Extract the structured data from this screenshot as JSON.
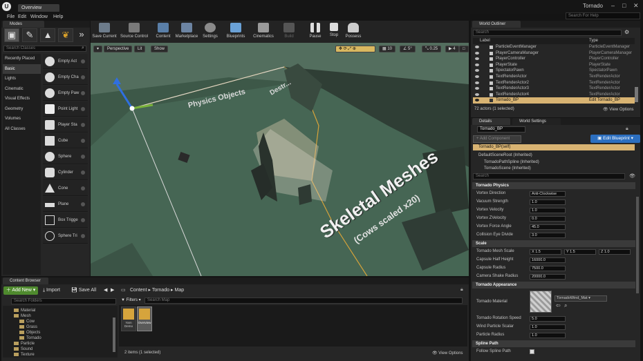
{
  "window": {
    "map_tab": "Overview",
    "project": "Tornado",
    "help_search_placeholder": "Search For Help"
  },
  "menu": [
    "File",
    "Edit",
    "Window",
    "Help"
  ],
  "modes": {
    "tab": "Modes",
    "search_placeholder": "Search Classes",
    "categories": [
      "Recently Placed",
      "Basic",
      "Lights",
      "Cinematic",
      "Visual Effects",
      "Geometry",
      "Volumes",
      "All Classes"
    ],
    "selected_category": "Basic",
    "actors": [
      "Empty Act",
      "Empty Cha",
      "Empty Paw",
      "Point Light",
      "Player Sta",
      "Cube",
      "Sphere",
      "Cylinder",
      "Cone",
      "Plane",
      "Box Trigge",
      "Sphere Tri"
    ]
  },
  "toolbar": [
    "Save Current",
    "Source Control",
    "Content",
    "Marketplace",
    "Settings",
    "Blueprints",
    "Cinematics",
    "Build",
    "Pause",
    "Stop",
    "Possess"
  ],
  "viewport": {
    "buttons": [
      "Perspective",
      "Lit",
      "Show"
    ],
    "snap_grid": "10",
    "snap_rot": "5°",
    "snap_scale": "0.25",
    "camera_speed": "4",
    "labels": {
      "physics": "Physics Objects",
      "destructible": "Destr...",
      "skeletal": "Skeletal Meshes",
      "cows": "(Cows scaled x20)"
    }
  },
  "world_outliner": {
    "tab": "World Outliner",
    "search_placeholder": "Search",
    "col_label": "Label",
    "col_type": "Type",
    "rows": [
      [
        "ParticleEventManager",
        "ParticleEventManager"
      ],
      [
        "PlayerCameraManager",
        "PlayerCameraManager"
      ],
      [
        "PlayerController",
        "PlayerController"
      ],
      [
        "PlayerState",
        "PlayerState"
      ],
      [
        "SpectatorPawn",
        "SpectatorPawn"
      ],
      [
        "TextRenderActor",
        "TextRenderActor"
      ],
      [
        "TextRenderActor2",
        "TextRenderActor"
      ],
      [
        "TextRenderActor3",
        "TextRenderActor"
      ],
      [
        "TextRenderActor4",
        "TextRenderActor"
      ],
      [
        "Tornado_BP",
        "Edit Tornado_BP"
      ]
    ],
    "selected": "Tornado_BP",
    "count": "72 actors (1 selected)",
    "view_options": "View Options"
  },
  "details": {
    "tab": "Details",
    "tab2": "World Settings",
    "name": "Tornado_BP",
    "add_component": "+ Add Component",
    "edit_blueprint": "Edit Blueprint",
    "components": [
      "Tornado_BP(self)",
      "DefaultSceneRoot (Inherited)",
      "TornadoPathSpline (Inherited)",
      "TornadoScene (Inherited)"
    ],
    "search_placeholder": "Search",
    "physics_title": "Tornado Physics",
    "physics": [
      [
        "Vortex Direction",
        "Anti-Clockwise"
      ],
      [
        "Vacuum Strength",
        "1.0"
      ],
      [
        "Vortex Velocity",
        "1.0"
      ],
      [
        "Vortex ZVelocity",
        "0.0"
      ],
      [
        "Vortex Force Angle",
        "45.0"
      ],
      [
        "Collision Eye Divide",
        "3.0"
      ]
    ],
    "scale_title": "Scale",
    "mesh_scale": {
      "label": "Tornado Mesh Scale",
      "x": "1.5",
      "y": "1.5",
      "z": "1.0"
    },
    "scale": [
      [
        "Capsule Half Height",
        "16000.0"
      ],
      [
        "Capsule Radius",
        "7500.0"
      ],
      [
        "Camera Shake Radius",
        "20000.0"
      ]
    ],
    "appearance_title": "Tornado Appearance",
    "material_label": "Tornado Material",
    "material": "TornadoWind_Mat",
    "appearance": [
      [
        "Tornado Rotation Speed",
        "5.0"
      ],
      [
        "Wind Particle Scalar",
        "1.0"
      ],
      [
        "Particle Radius",
        "1.0"
      ]
    ],
    "spline_title": "Spline Path",
    "spline_row": "Follow Spline Path"
  },
  "content_browser": {
    "tab": "Content Browser",
    "add_new": "Add New",
    "import": "Import",
    "save_all": "Save All",
    "path": [
      "Content",
      "Tornado",
      "Map"
    ],
    "search_folders": "Search Folders",
    "filters": "Filters",
    "search_map": "Search Map",
    "folders": [
      "Material",
      "Mesh",
      "Cow",
      "Grass",
      "Objects",
      "Tornado",
      "Particle",
      "Sound",
      "Texture"
    ],
    "assets": [
      "Yarn Demo",
      "Overview"
    ],
    "count": "2 items (1 selected)",
    "view_options": "View Options"
  },
  "colors": {
    "accent_orange": "#d8b372",
    "blueprint_blue": "#2c6fc0",
    "ground": "#3f5a47"
  }
}
